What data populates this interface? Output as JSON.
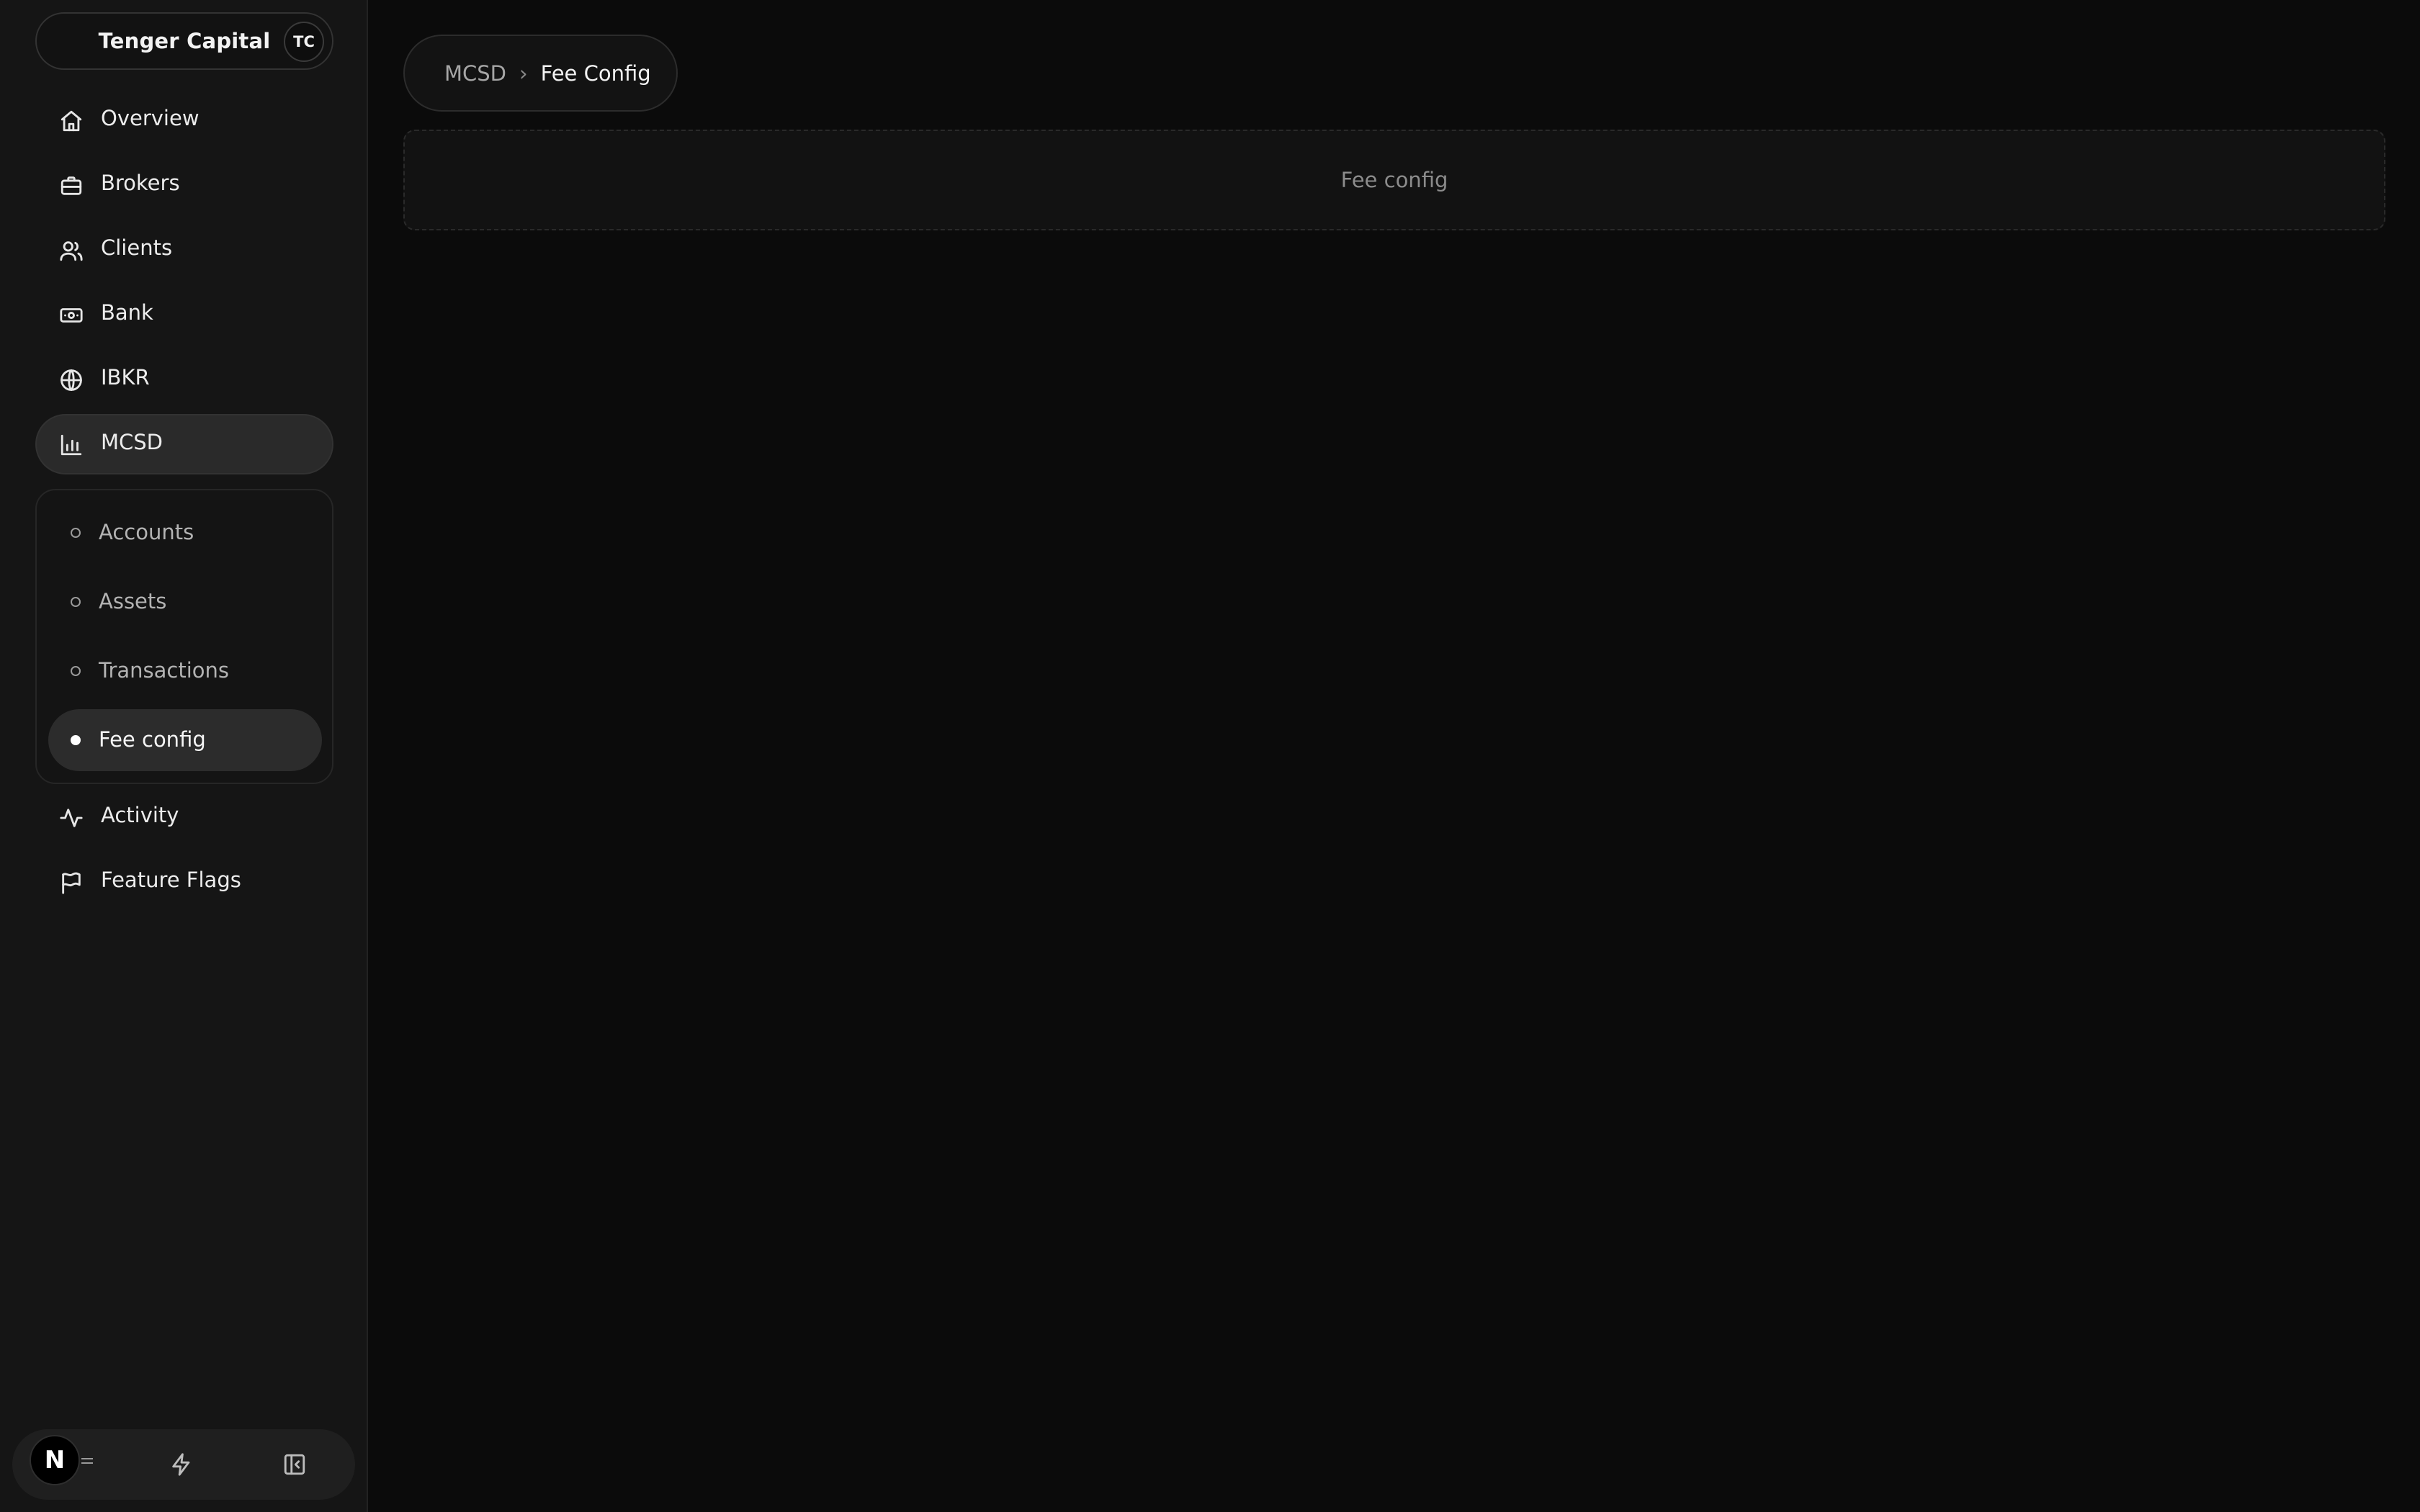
{
  "org": {
    "name": "Tenger Capital",
    "initials": "TC"
  },
  "nav": {
    "items": [
      {
        "label": "Overview",
        "icon": "home-icon"
      },
      {
        "label": "Brokers",
        "icon": "briefcase-icon"
      },
      {
        "label": "Clients",
        "icon": "users-icon"
      },
      {
        "label": "Bank",
        "icon": "banknote-icon"
      },
      {
        "label": "IBKR",
        "icon": "globe-icon"
      },
      {
        "label": "MCSD",
        "icon": "bar-chart-icon",
        "active": true
      },
      {
        "label": "Activity",
        "icon": "activity-icon"
      },
      {
        "label": "Feature Flags",
        "icon": "flag-icon"
      }
    ],
    "subitems": [
      {
        "label": "Accounts"
      },
      {
        "label": "Assets"
      },
      {
        "label": "Transactions"
      },
      {
        "label": "Fee config",
        "active": true
      }
    ]
  },
  "bottom_bar": {
    "badge": "N"
  },
  "breadcrumb": {
    "parent": "MCSD",
    "separator": "›",
    "current": "Fee Config"
  },
  "main": {
    "placeholder": "Fee config"
  },
  "colors": {
    "background": "#0b0b0b",
    "sidebar": "#151515",
    "active": "#2a2a2a"
  }
}
